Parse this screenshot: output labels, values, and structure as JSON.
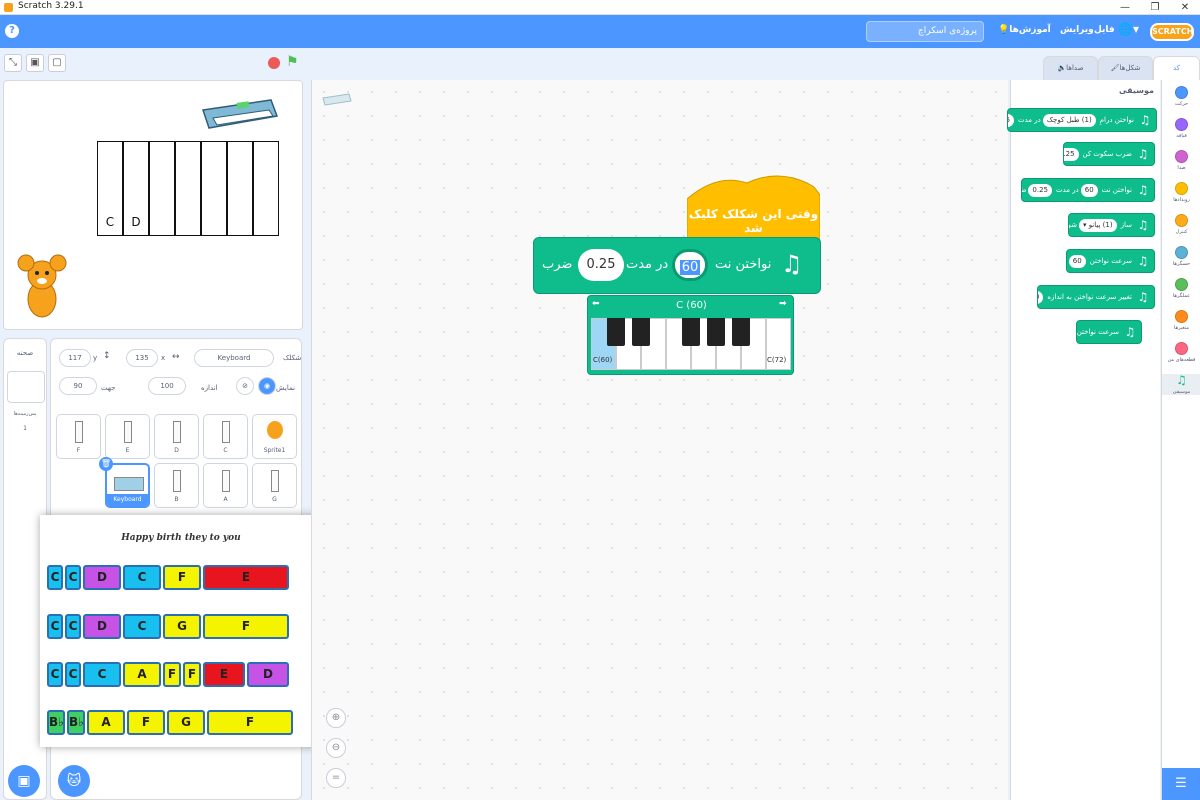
{
  "window": {
    "title": "Scratch 3.29.1",
    "min": "—",
    "restore": "❐",
    "close": "✕"
  },
  "menubar": {
    "help": "?",
    "project_title": "پروژه‌ی اسکراچ",
    "tutorials": "آموزش‌ها",
    "edit": "ویرایش",
    "file": "فایل",
    "language_icon": "globe-icon",
    "logo": "SCRATCH"
  },
  "tabs": {
    "code": "کد",
    "costumes": "شکل‌ها",
    "sounds": "صداها"
  },
  "categories": [
    {
      "label": "حرکت",
      "color": "#4c97ff"
    },
    {
      "label": "قیافه",
      "color": "#9966ff"
    },
    {
      "label": "صدا",
      "color": "#cf63cf"
    },
    {
      "label": "رویدادها",
      "color": "#ffbf00"
    },
    {
      "label": "کنترل",
      "color": "#ffab19"
    },
    {
      "label": "حسگرها",
      "color": "#5cb1d6"
    },
    {
      "label": "عملگرها",
      "color": "#59c059"
    },
    {
      "label": "متغیرها",
      "color": "#ff8c1a"
    },
    {
      "label": "قطعه‌های من",
      "color": "#ff6680"
    },
    {
      "label": "موسیقی",
      "color": "#0fbd8c"
    }
  ],
  "palette": {
    "heading": "موسیقی",
    "blocks": [
      {
        "pre": "نواختن درامِ",
        "pill": "(1) طبل کوچک",
        "post": "در مدت",
        "val": "0.25"
      },
      {
        "pre": "ضرب سکوت کن",
        "val": "0.25"
      },
      {
        "pre": "نواختن نت",
        "pill": "60",
        "post": "در مدت",
        "val": "0.25",
        "tail": "ضرب"
      },
      {
        "pre": "ساز",
        "pill": "(1) پیانو ▾",
        "tail": "شود"
      },
      {
        "pre": "سرعت نواختن",
        "pill": "60",
        "tail": "شود"
      },
      {
        "pre": "تغییر سرعت نواختن به اندازه",
        "pill": "20"
      },
      {
        "pre": "سرعت نواختن"
      }
    ]
  },
  "script": {
    "hat": "وقتی این شکلک کلیک شد",
    "play_label": "نواختن نت",
    "note_value": "60",
    "for_label": "در مدت",
    "beats_value": "0.25",
    "beats_label": "ضرب",
    "piano_title": "C (60)",
    "piano_low": "C(60)",
    "piano_high": "C(72)"
  },
  "sprite_info": {
    "sprite_label": "شکلک",
    "sprite_name": "Keyboard",
    "x_label": "x",
    "x_value": "135",
    "y_label": "y",
    "y_value": "117",
    "show_label": "نمایش",
    "size_label": "اندازه",
    "size_value": "100",
    "direction_label": "جهت",
    "direction_value": "90"
  },
  "stage_panel": {
    "title": "صحنه",
    "backdrops_label": "پس‌زمینه‌ها",
    "backdrops_count": "1"
  },
  "sprites": [
    {
      "name": "F"
    },
    {
      "name": "E"
    },
    {
      "name": "D"
    },
    {
      "name": "C"
    },
    {
      "name": "Sprite1"
    },
    {
      "name": "Keyboard"
    },
    {
      "name": "B"
    },
    {
      "name": "A"
    },
    {
      "name": "G"
    }
  ],
  "stage": {
    "key_labels": [
      "C",
      "D"
    ]
  },
  "song": {
    "title": "Happy birth they to you",
    "rows": [
      [
        {
          "n": "C",
          "c": "#18c0f0"
        },
        {
          "n": "C",
          "c": "#18c0f0"
        },
        {
          "n": "D",
          "c": "#c653e6"
        },
        {
          "n": "C",
          "c": "#18c0f0"
        },
        {
          "n": "F",
          "c": "#f4f400"
        },
        {
          "n": "E",
          "c": "#e8141e"
        }
      ],
      [
        {
          "n": "C",
          "c": "#18c0f0"
        },
        {
          "n": "C",
          "c": "#18c0f0"
        },
        {
          "n": "D",
          "c": "#c653e6"
        },
        {
          "n": "C",
          "c": "#18c0f0"
        },
        {
          "n": "G",
          "c": "#f4f400"
        },
        {
          "n": "F",
          "c": "#f4f400"
        }
      ],
      [
        {
          "n": "C",
          "c": "#18c0f0"
        },
        {
          "n": "C",
          "c": "#18c0f0"
        },
        {
          "n": "C",
          "c": "#18c0f0"
        },
        {
          "n": "A",
          "c": "#f4f400"
        },
        {
          "n": "F",
          "c": "#f4f400"
        },
        {
          "n": "F",
          "c": "#f4f400"
        },
        {
          "n": "E",
          "c": "#e8141e"
        },
        {
          "n": "D",
          "c": "#c653e6"
        }
      ],
      [
        {
          "n": "B♭",
          "c": "#3fcf62"
        },
        {
          "n": "B♭",
          "c": "#3fcf62"
        },
        {
          "n": "A",
          "c": "#f4f400"
        },
        {
          "n": "F",
          "c": "#f4f400"
        },
        {
          "n": "G",
          "c": "#f4f400"
        },
        {
          "n": "F",
          "c": "#f4f400"
        }
      ]
    ]
  }
}
